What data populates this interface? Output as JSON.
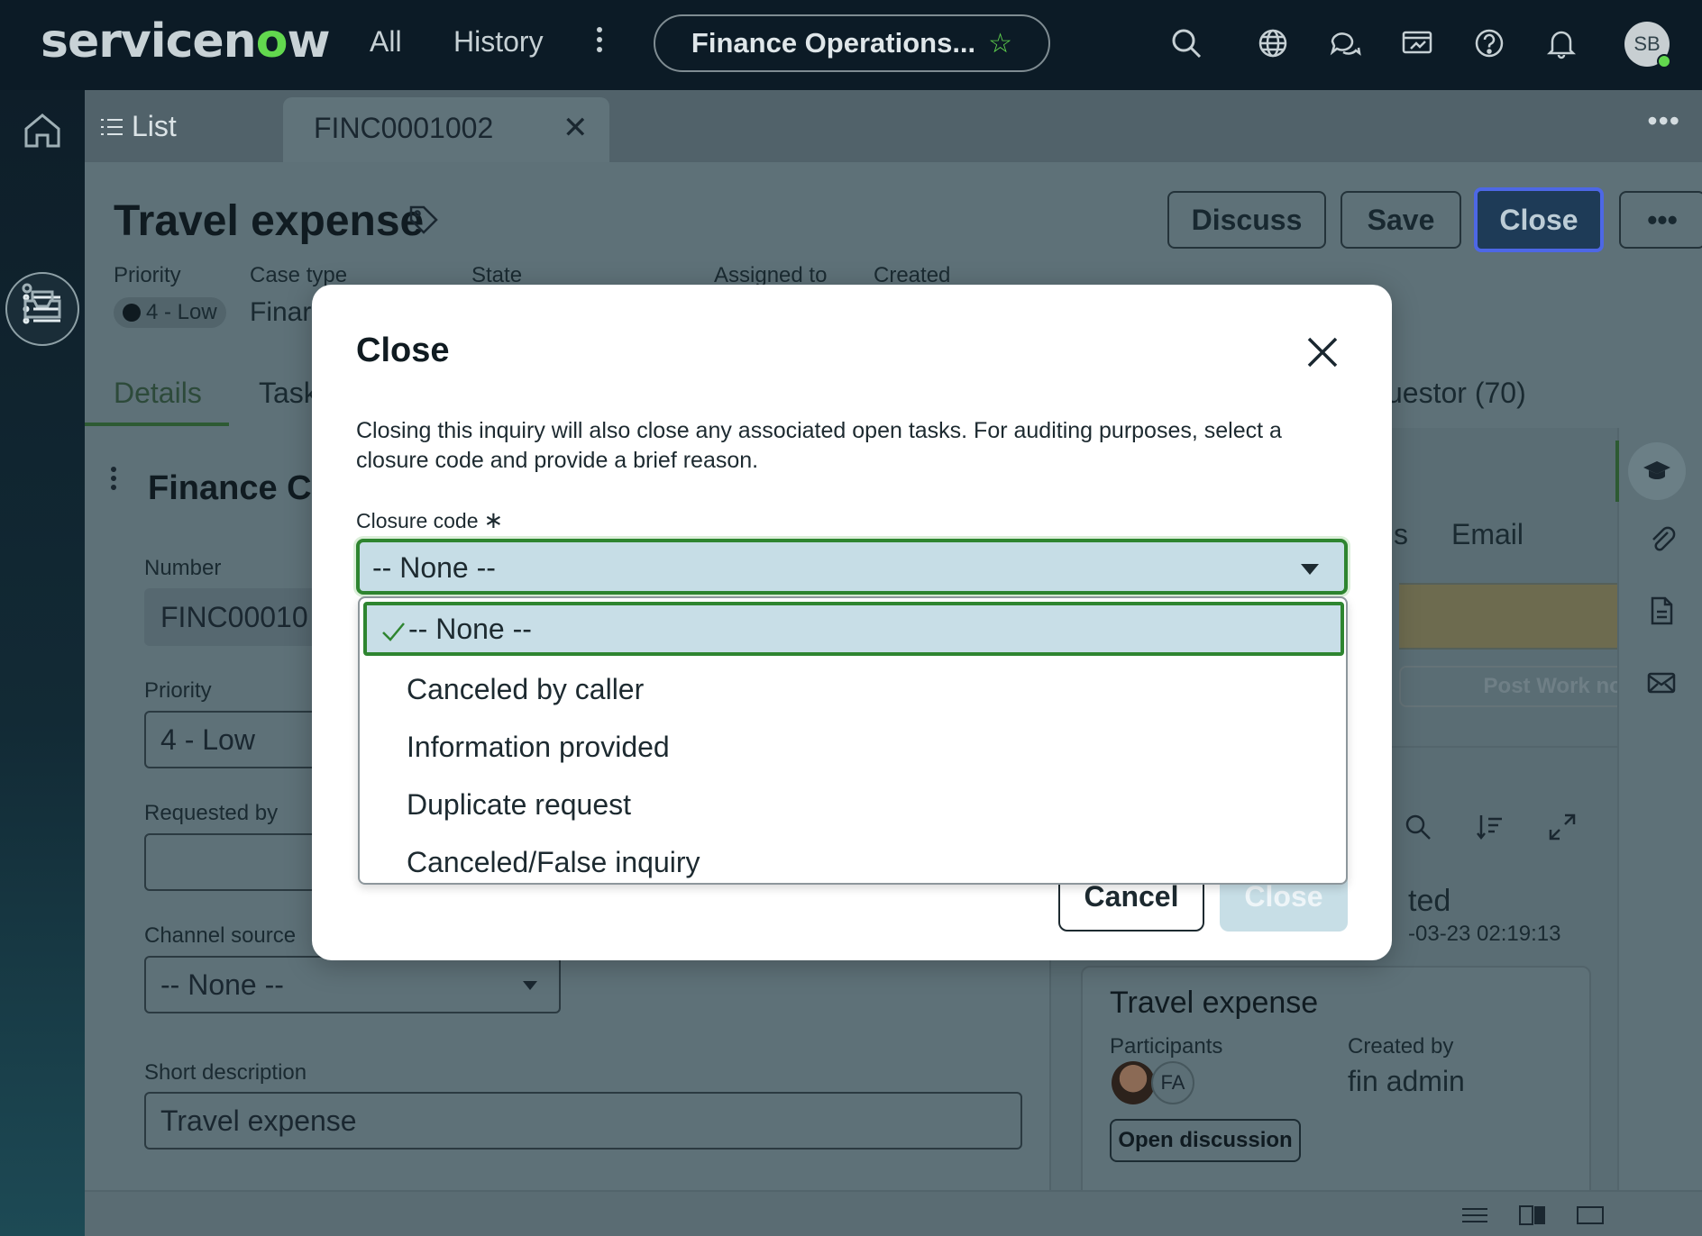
{
  "topbar": {
    "logo_text_a": "servicen",
    "logo_text_o": "o",
    "logo_text_b": "w",
    "nav_all": "All",
    "nav_history": "History",
    "workspace_title": "Finance Operations...",
    "user_initials": "SB",
    "icons": [
      "search-icon",
      "globe-icon",
      "chat-icon",
      "screen-share-icon",
      "help-icon",
      "bell-icon"
    ]
  },
  "tabs": {
    "list_label": "List",
    "case_tab_label": "FINC0001002",
    "more": "•••"
  },
  "header": {
    "title": "Travel expense",
    "buttons": {
      "discuss": "Discuss",
      "save": "Save",
      "close": "Close",
      "more": "•••"
    },
    "meta": {
      "priority_label": "Priority",
      "priority_value": "4 - Low",
      "case_type_label": "Case type",
      "case_type_value": "Finar",
      "state_label": "State",
      "assigned_to_label": "Assigned to",
      "created_label": "Created"
    },
    "detail_tabs": {
      "details": "Details",
      "tasks": "Task",
      "requestor": "uestor (70)"
    }
  },
  "form": {
    "section_title": "Finance Ca",
    "number_label": "Number",
    "number_value": "FINC00010",
    "priority_label": "Priority",
    "priority_value": "4 - Low",
    "requested_by_label": "Requested by",
    "requested_by_value": "",
    "channel_source_label": "Channel source",
    "channel_source_value": "-- None --",
    "short_description_label": "Short description",
    "short_description_value": "Travel expense"
  },
  "activity": {
    "tab_partial": "s",
    "tab_email": "Email",
    "post_button": "Post Work notes",
    "created_title": "ted",
    "created_date": "-03-23 02:19:13",
    "card": {
      "title": "Travel expense",
      "participants_label": "Participants",
      "participant_initials": "FA",
      "created_by_label": "Created by",
      "created_by_value": "fin admin",
      "open_discussion": "Open discussion"
    }
  },
  "modal": {
    "title": "Close",
    "description": "Closing this inquiry will also close any associated open tasks. For auditing purposes, select a closure code and provide a brief reason.",
    "closure_code_label": "Closure code",
    "required_mark": "∗",
    "closure_code_value": "-- None --",
    "cancel_button": "Cancel",
    "close_button": "Close",
    "options": [
      {
        "label": "-- None --",
        "selected": true
      },
      {
        "label": "Canceled by caller",
        "selected": false
      },
      {
        "label": "Information provided",
        "selected": false
      },
      {
        "label": "Duplicate request",
        "selected": false
      },
      {
        "label": "Canceled/False inquiry",
        "selected": false
      }
    ]
  },
  "colors": {
    "topbar_bg": "#0c1b26",
    "accent_green": "#62d84e",
    "select_border": "#2e8530",
    "select_bg": "#c6dde6",
    "primary_button": "#1e3b57",
    "overlay_page": "#5f7178"
  }
}
